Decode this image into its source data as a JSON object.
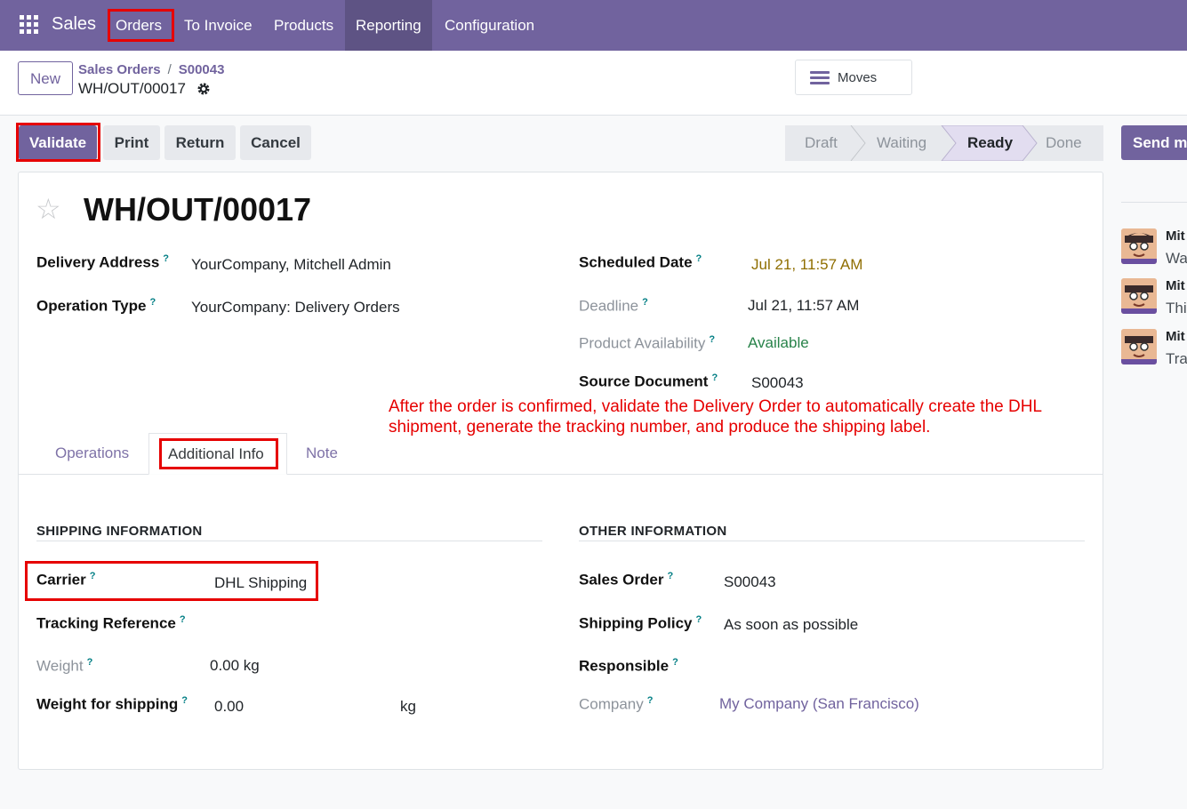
{
  "nav": {
    "app": "Sales",
    "menus": [
      "Orders",
      "To Invoice",
      "Products",
      "Reporting",
      "Configuration"
    ]
  },
  "control": {
    "new_label": "New",
    "breadcrumb": [
      "Sales Orders",
      "S00043"
    ],
    "breadcrumb_sep": "/",
    "current": "WH/OUT/00017",
    "moves_label": "Moves"
  },
  "actions": {
    "validate": "Validate",
    "print": "Print",
    "return": "Return",
    "cancel": "Cancel",
    "send": "Send m"
  },
  "statusbar": {
    "steps": [
      "Draft",
      "Waiting",
      "Ready",
      "Done"
    ],
    "current": "Ready"
  },
  "record": {
    "title": "WH/OUT/00017",
    "help_mark": "?",
    "left": {
      "delivery_address_label": "Delivery Address",
      "delivery_address": "YourCompany, Mitchell Admin",
      "operation_type_label": "Operation Type",
      "operation_type": "YourCompany: Delivery Orders"
    },
    "right": {
      "scheduled_date_label": "Scheduled Date",
      "scheduled_date": "Jul 21, 11:57 AM",
      "deadline_label": "Deadline",
      "deadline": "Jul 21, 11:57 AM",
      "availability_label": "Product Availability",
      "availability": "Available",
      "source_label": "Source Document",
      "source": "S00043"
    }
  },
  "annotation": "After the order is confirmed, validate the Delivery Order to automatically create the DHL shipment, generate the tracking number, and produce the shipping label.",
  "tabs": [
    "Operations",
    "Additional Info",
    "Note"
  ],
  "shipping": {
    "header": "SHIPPING INFORMATION",
    "carrier_label": "Carrier",
    "carrier": "DHL Shipping",
    "tracking_label": "Tracking Reference",
    "tracking": "",
    "weight_label": "Weight",
    "weight": "0.00 kg",
    "weight_ship_label": "Weight for shipping",
    "weight_ship": "0.00",
    "weight_ship_unit": "kg"
  },
  "other": {
    "header": "OTHER INFORMATION",
    "sales_order_label": "Sales Order",
    "sales_order": "S00043",
    "policy_label": "Shipping Policy",
    "policy": "As soon as possible",
    "responsible_label": "Responsible",
    "responsible": "",
    "company_label": "Company",
    "company": "My Company (San Francisco)"
  },
  "chatter": [
    {
      "author": "Mit",
      "text": "Wa"
    },
    {
      "author": "Mit",
      "text": "Thi"
    },
    {
      "author": "Mit",
      "text": "Tra"
    }
  ],
  "colors": {
    "brand": "#71639e",
    "highlight": "#e60000",
    "available": "#28834a",
    "scheduled": "#8f6e00"
  }
}
